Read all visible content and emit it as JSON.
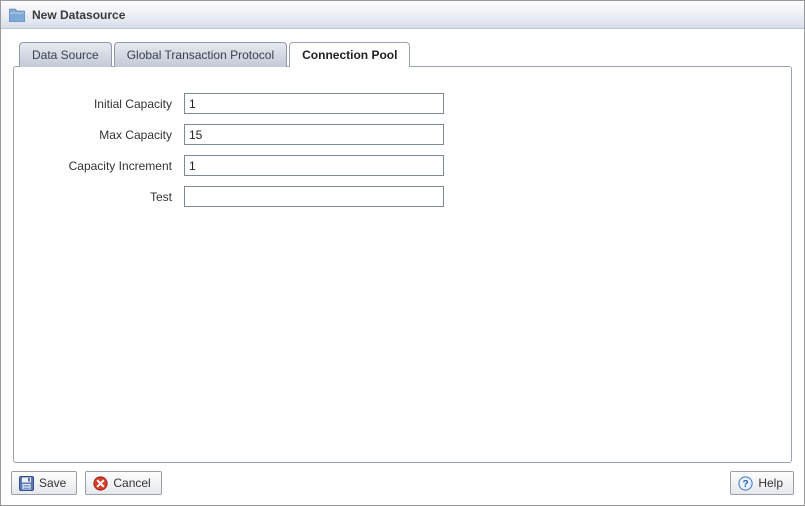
{
  "window": {
    "title": "New Datasource"
  },
  "tabs": {
    "0": {
      "label": "Data Source"
    },
    "1": {
      "label": "Global Transaction Protocol"
    },
    "2": {
      "label": "Connection Pool"
    }
  },
  "form": {
    "initial_capacity": {
      "label": "Initial Capacity",
      "value": "1"
    },
    "max_capacity": {
      "label": "Max Capacity",
      "value": "15"
    },
    "capacity_increment": {
      "label": "Capacity Increment",
      "value": "1"
    },
    "test": {
      "label": "Test",
      "value": ""
    }
  },
  "buttons": {
    "save": "Save",
    "cancel": "Cancel",
    "help": "Help"
  }
}
